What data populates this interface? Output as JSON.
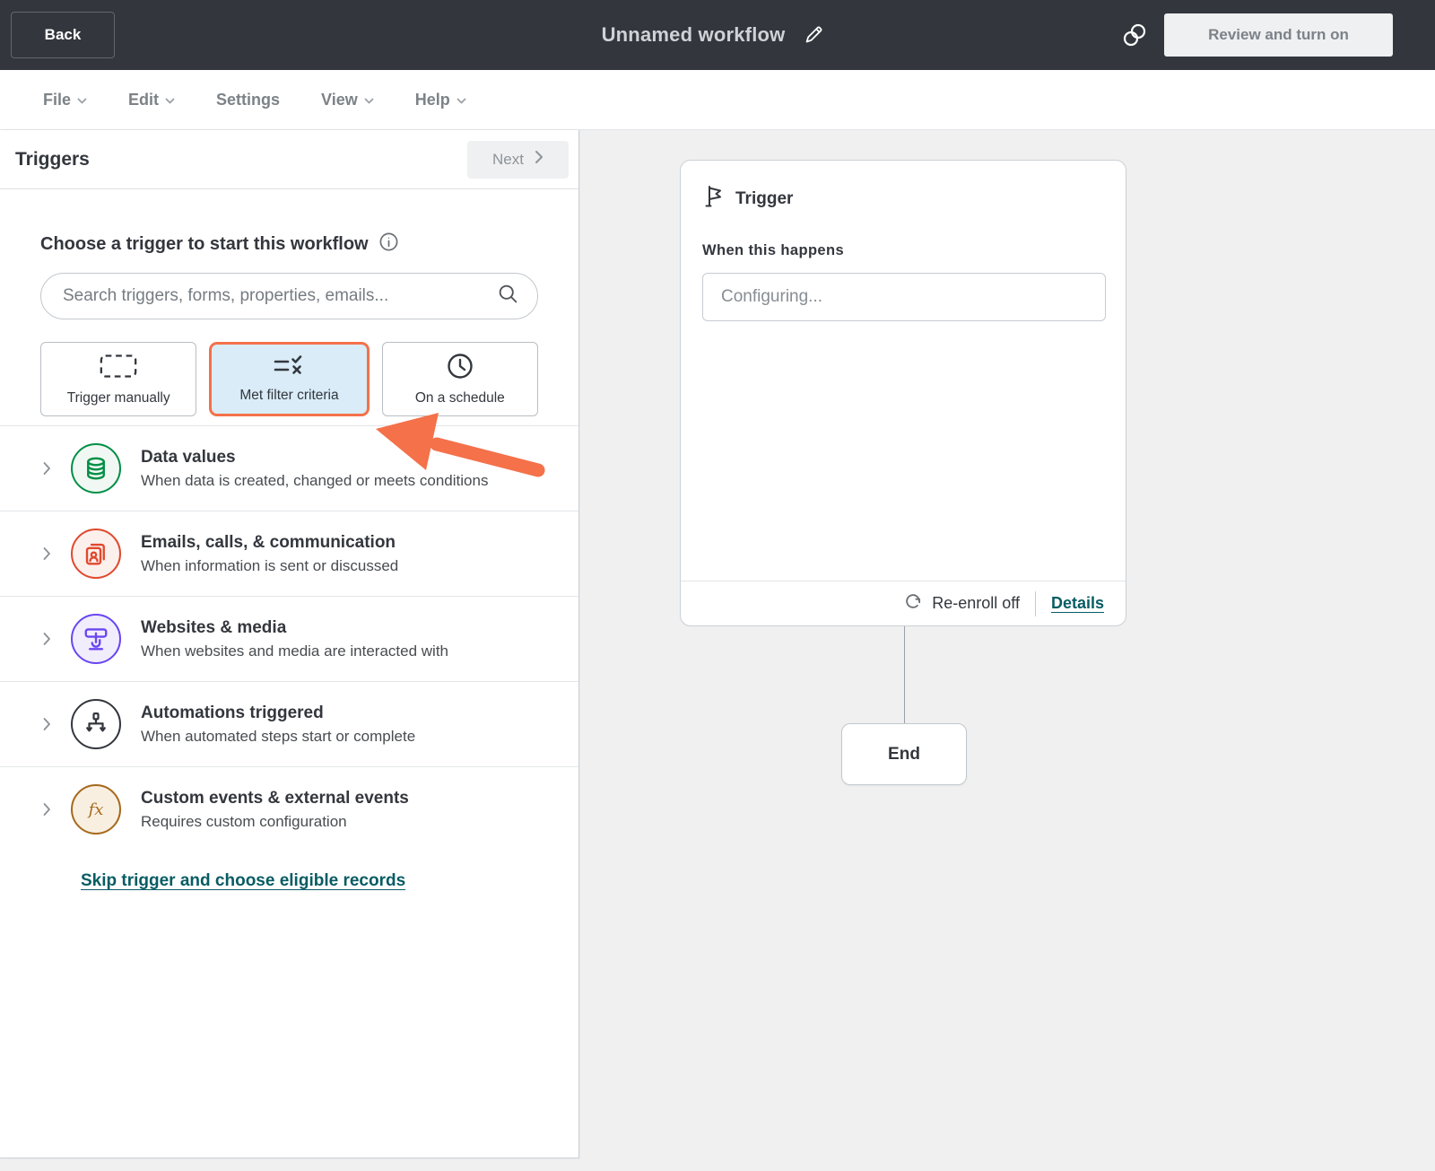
{
  "topbar": {
    "back_label": "Back",
    "title": "Unnamed workflow",
    "review_label": "Review and turn on"
  },
  "menubar": {
    "items": [
      {
        "label": "File",
        "chevron": true
      },
      {
        "label": "Edit",
        "chevron": true
      },
      {
        "label": "Settings",
        "chevron": false
      },
      {
        "label": "View",
        "chevron": true
      },
      {
        "label": "Help",
        "chevron": true
      }
    ]
  },
  "panel": {
    "title": "Triggers",
    "next_label": "Next",
    "heading": "Choose a trigger to start this workflow",
    "search_placeholder": "Search triggers, forms, properties, emails...",
    "quick_triggers": [
      {
        "label": "Trigger manually",
        "icon": "dashed-box-icon",
        "selected": false
      },
      {
        "label": "Met filter criteria",
        "icon": "filter-criteria-icon",
        "selected": true
      },
      {
        "label": "On a schedule",
        "icon": "clock-icon",
        "selected": false
      }
    ],
    "categories": [
      {
        "title": "Data values",
        "subtitle": "When data is created, changed or meets conditions",
        "icon": "database-icon",
        "color": "#008f45",
        "bg": "#f1f8f3"
      },
      {
        "title": "Emails, calls, & communication",
        "subtitle": "When information is sent or discussed",
        "icon": "contact-card-icon",
        "color": "#e0492e",
        "bg": "#fcf0ec"
      },
      {
        "title": "Websites & media",
        "subtitle": "When websites and media are interacted with",
        "icon": "tap-icon",
        "color": "#6a46f2",
        "bg": "#f1edfd"
      },
      {
        "title": "Automations triggered",
        "subtitle": "When automated steps start or complete",
        "icon": "automation-icon",
        "color": "#33373d",
        "bg": "#ffffff"
      },
      {
        "title": "Custom events & external events",
        "subtitle": "Requires custom configuration",
        "icon": "fx-icon",
        "color": "#a5691c",
        "bg": "#f9efe1"
      }
    ],
    "skip_link": "Skip trigger and choose eligible records"
  },
  "canvas": {
    "trigger_card": {
      "title": "Trigger",
      "subtitle": "When this happens",
      "input_placeholder": "Configuring...",
      "reenroll_label": "Re-enroll off",
      "details_label": "Details"
    },
    "end_label": "End"
  },
  "colors": {
    "topbar_bg": "#33373d",
    "accent_orange": "#f4714a",
    "selected_card_bg": "#d9ecf8",
    "link_teal": "#085c63",
    "canvas_bg": "#f0f0f1"
  }
}
